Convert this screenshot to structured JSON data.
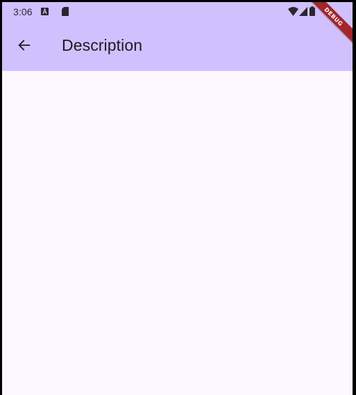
{
  "status_bar": {
    "time": "3:06"
  },
  "app_bar": {
    "title": "Description"
  },
  "debug_banner": {
    "label": "DEBUG"
  },
  "colors": {
    "app_bar_background": "#d1c0fe",
    "page_background": "#fdf7ff",
    "debug_banner": "#a3262a"
  },
  "icons": {
    "status_left": [
      "a-notification-icon",
      "sd-card-icon"
    ],
    "status_right": [
      "wifi-icon",
      "signal-icon",
      "battery-icon"
    ],
    "app_bar_leading": "arrow-back-icon"
  }
}
